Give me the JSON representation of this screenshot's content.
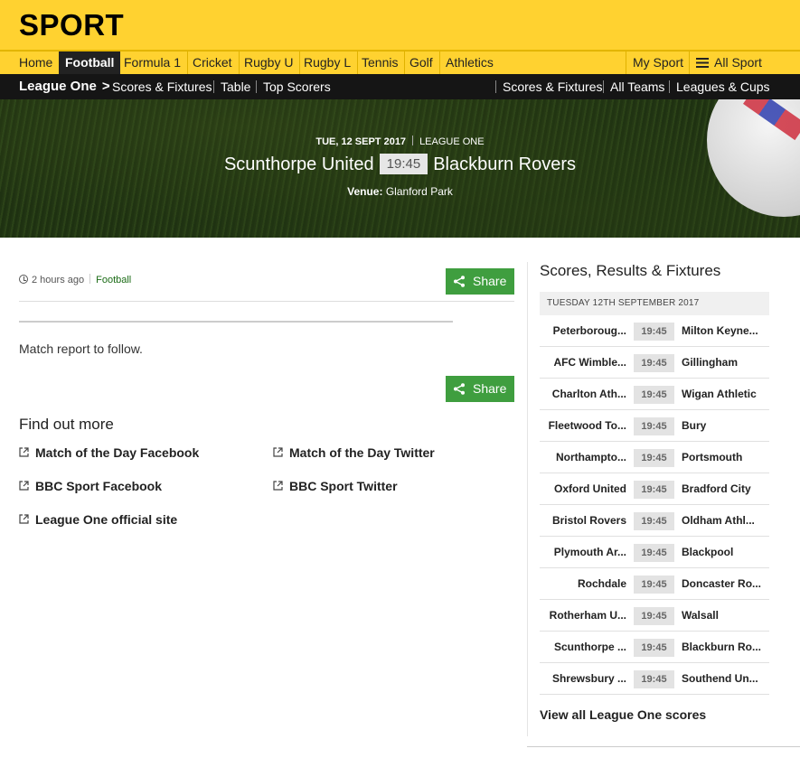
{
  "header": {
    "logo": "SPORT"
  },
  "nav_primary": {
    "items": [
      "Home",
      "Football",
      "Formula 1",
      "Cricket",
      "Rugby U",
      "Rugby L",
      "Tennis",
      "Golf",
      "Athletics"
    ],
    "active": "Football",
    "my_sport": "My Sport",
    "all_sport": "All Sport"
  },
  "nav_secondary": {
    "section": "League One",
    "left_links": [
      "Scores & Fixtures",
      "Table",
      "Top Scorers"
    ],
    "right_links": [
      "Scores & Fixtures",
      "All Teams",
      "Leagues & Cups"
    ]
  },
  "match": {
    "date": "TUE, 12 SEPT 2017",
    "league": "LEAGUE ONE",
    "home": "Scunthorpe United",
    "time": "19:45",
    "away": "Blackburn Rovers",
    "venue_label": "Venue:",
    "venue": "Glanford Park"
  },
  "article": {
    "timestamp": "2 hours ago",
    "topic": "Football",
    "share_label": "Share",
    "report_text": "Match report to follow.",
    "find_out_more": "Find out more",
    "links": [
      "Match of the Day Facebook",
      "Match of the Day Twitter",
      "BBC Sport Facebook",
      "BBC Sport Twitter",
      "League One official site"
    ]
  },
  "sidebar": {
    "title": "Scores, Results & Fixtures",
    "date": "TUESDAY 12TH SEPTEMBER 2017",
    "fixtures": [
      {
        "home": "Peterboroug...",
        "time": "19:45",
        "away": "Milton Keyne..."
      },
      {
        "home": "AFC Wimble...",
        "time": "19:45",
        "away": "Gillingham"
      },
      {
        "home": "Charlton Ath...",
        "time": "19:45",
        "away": "Wigan Athletic"
      },
      {
        "home": "Fleetwood To...",
        "time": "19:45",
        "away": "Bury"
      },
      {
        "home": "Northampto...",
        "time": "19:45",
        "away": "Portsmouth"
      },
      {
        "home": "Oxford United",
        "time": "19:45",
        "away": "Bradford City"
      },
      {
        "home": "Bristol Rovers",
        "time": "19:45",
        "away": "Oldham Athl..."
      },
      {
        "home": "Plymouth Ar...",
        "time": "19:45",
        "away": "Blackpool"
      },
      {
        "home": "Rochdale",
        "time": "19:45",
        "away": "Doncaster Ro..."
      },
      {
        "home": "Rotherham U...",
        "time": "19:45",
        "away": "Walsall"
      },
      {
        "home": "Scunthorpe ...",
        "time": "19:45",
        "away": "Blackburn Ro..."
      },
      {
        "home": "Shrewsbury ...",
        "time": "19:45",
        "away": "Southend Un..."
      }
    ],
    "view_all": "View all League One scores"
  },
  "colors": {
    "brand_yellow": "#ffd230",
    "share_green": "#3f9e3f",
    "nav_dark": "#151515"
  }
}
